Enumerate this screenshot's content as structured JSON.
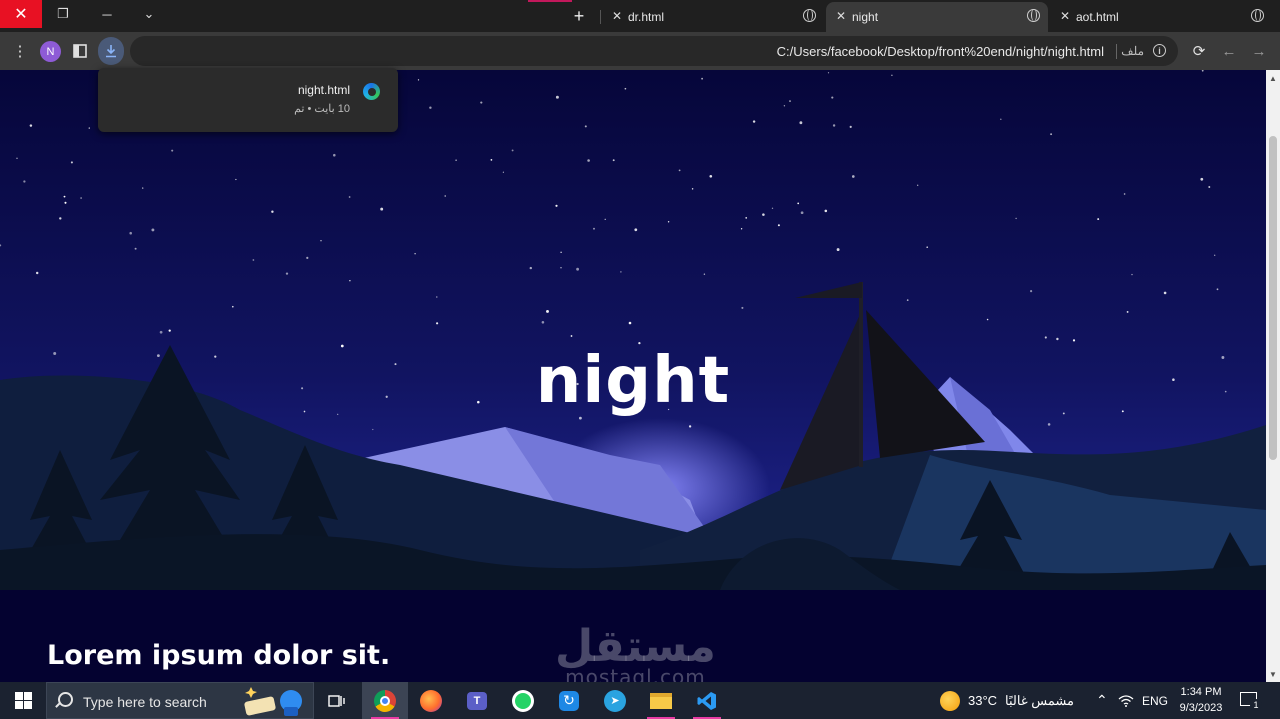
{
  "browser": {
    "tabs": [
      {
        "title": "dr.html",
        "active": false
      },
      {
        "title": "night",
        "active": true
      },
      {
        "title": "aot.html",
        "active": false
      }
    ],
    "new_tab_symbol": "+",
    "profile_initial": "N",
    "url": "C:/Users/facebook/Desktop/front%20end/night/night.html",
    "scheme_label": "ملف"
  },
  "downloads_popup": {
    "file_name": "night.html",
    "meta": "10 بايت • تم"
  },
  "page": {
    "hero_title": "night",
    "section_title": "Lorem ipsum dolor sit.",
    "watermark_ar": "مستقل",
    "watermark_latin": "mostaql.com"
  },
  "taskbar": {
    "search_placeholder": "Type here to search",
    "weather_temp": "33°C",
    "weather_text": "مشمس غالبًا",
    "language": "ENG",
    "time": "1:34 PM",
    "date": "9/3/2023",
    "notification_count": "1",
    "apps": [
      "task-view",
      "chrome",
      "firefox",
      "teams",
      "whatsapp",
      "sync-app",
      "telegram",
      "file-explorer",
      "vscode"
    ]
  },
  "colors": {
    "sky_top": "#06063a",
    "sky_bottom": "#2b34a8",
    "section_bg": "#040230",
    "close_button": "#e81123",
    "taskbar_indicator": "#e93ba4"
  }
}
